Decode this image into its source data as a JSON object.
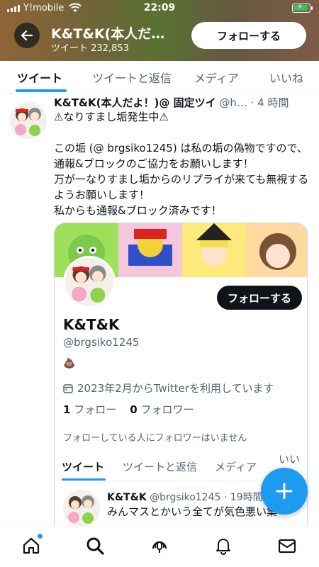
{
  "status_bar": {
    "carrier": "Y!mobile",
    "time": "22:09"
  },
  "header": {
    "title": "K&T&K(本人だ…",
    "tweet_count": "ツイート 232,853",
    "follow_label": "フォローする"
  },
  "tabs": [
    {
      "label": "ツイート"
    },
    {
      "label": "ツイートと返信"
    },
    {
      "label": "メディア"
    },
    {
      "label": "いいね"
    }
  ],
  "tweet": {
    "name": "K&T&K(本人だよ！)@ 固定ツイ",
    "handle": " @h…",
    "time": " · 4 時間",
    "text": "⚠なりすまし垢発生中⚠\n\nこの垢 (@ brgsiko1245) は私の垢の偽物ですので、通報&ブロックのご協力をお願いします！\n万が一なりすまし垢からのリプライが来ても無視するようお願いします！\n私からも通報&ブロック済みです！"
  },
  "card": {
    "follow_label": "フォローする",
    "name": "K&T&K",
    "handle": "@brgsiko1245",
    "emoji": "💩",
    "joined": "2023年2月からTwitterを利用しています",
    "following_count": "1",
    "following_label": " フォロー",
    "followers_count": "0",
    "followers_label": " フォロワー",
    "note": "フォローしている人にフォロワーはいません",
    "tabs": [
      {
        "label": "ツイート"
      },
      {
        "label": "ツイートと返信"
      },
      {
        "label": "メディア"
      },
      {
        "label": "いいね"
      }
    ],
    "preview": {
      "name": "K&T&K",
      "handle": " @brgsiko1245",
      "time": " · 19時間",
      "text": "みんマスとかいう全てが気色悪い集"
    }
  },
  "fab": {
    "label": "+"
  },
  "colors": {
    "accent": "#1d9bf0",
    "text": "#0f1419",
    "secondary": "#536471"
  },
  "bottom_nav": [
    "home-icon",
    "search-icon",
    "spaces-icon",
    "bell-icon",
    "mail-icon"
  ]
}
